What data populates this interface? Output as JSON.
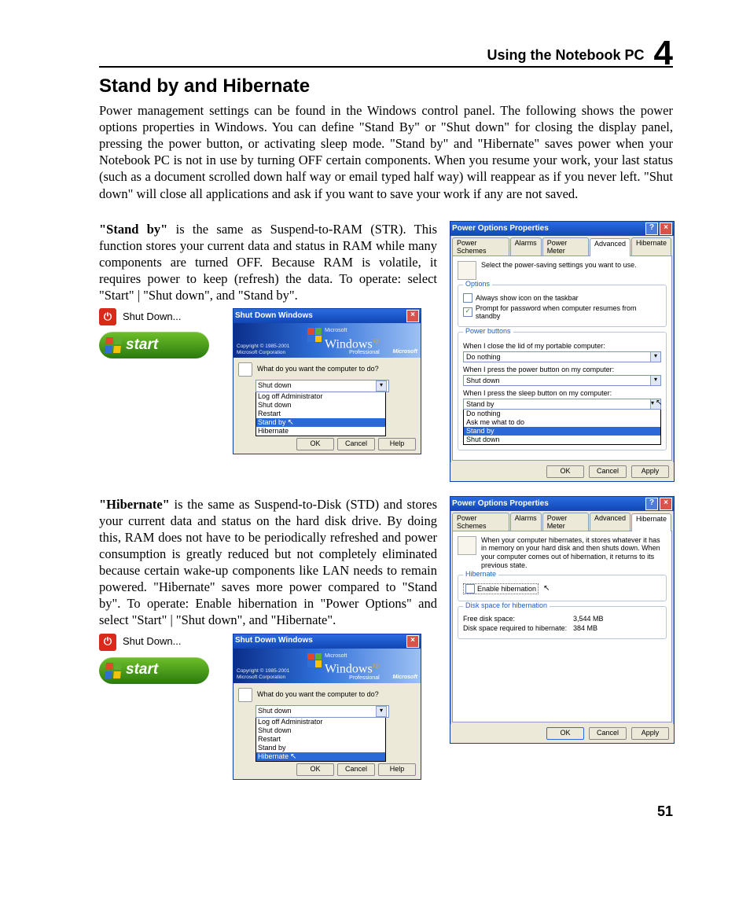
{
  "header": {
    "section_title": "Using the Notebook PC",
    "chapter_number": "4"
  },
  "h1": "Stand by and Hibernate",
  "intro": "Power management settings can be found in the Windows control panel. The following shows the power options properties in Windows. You can define \"Stand By\" or \"Shut down\" for closing the display panel, pressing the power button, or activating sleep mode. \"Stand by\" and \"Hibernate\" saves power when your Notebook PC is not in use by turning OFF certain components. When you resume your work, your last status (such as a document scrolled down half way or email typed half way) will reappear as if you never left. \"Shut down\" will close all applications and ask if you want to save your work if any are not saved.",
  "standby": {
    "bold": "\"Stand by\"",
    "text": " is the same as Suspend-to-RAM (STR). This function stores your current data and status in RAM while many components are turned OFF. Because RAM is volatile, it requires power to keep (refresh) the data. To operate: select \"Start\" | \"Shut down\", and \"Stand by\"."
  },
  "hibernate": {
    "bold": "\"Hibernate\"",
    "text": " is the same as  Suspend-to-Disk (STD) and stores your current data and status on the hard disk drive. By doing this, RAM does not have to be periodically refreshed and power consumption is greatly reduced but not completely eliminated because certain wake-up components like LAN needs to remain powered. \"Hibernate\" saves more power compared to \"Stand by\". To operate: Enable hibernation in \"Power Options\" and select \"Start\" | \"Shut down\", and \"Hibernate\"."
  },
  "start_button": {
    "label": "start"
  },
  "shutdown_item": {
    "label": "Shut Down..."
  },
  "shutdown_dialog": {
    "title": "Shut Down Windows",
    "banner": {
      "ms_top": "Microsoft",
      "product": "Windows",
      "suffix": "xp",
      "edition": "Professional",
      "copyright": "Copyright © 1985-2001\nMicrosoft Corporation",
      "msft": "Microsoft"
    },
    "question": "What do you want the computer to do?",
    "selected": "Shut down",
    "options_standby": [
      "Log off Administrator",
      "Shut down",
      "Restart",
      "Stand by",
      "Hibernate"
    ],
    "options_hibernate": [
      "Log off Administrator",
      "Shut down",
      "Restart",
      "Stand by",
      "Hibernate"
    ],
    "highlight_standby": "Stand by",
    "highlight_hibernate": "Hibernate",
    "buttons": {
      "ok": "OK",
      "cancel": "Cancel",
      "help": "Help"
    }
  },
  "power_options_adv": {
    "title": "Power Options Properties",
    "tabs": [
      "Power Schemes",
      "Alarms",
      "Power Meter",
      "Advanced",
      "Hibernate"
    ],
    "active_tab": "Advanced",
    "desc": "Select the power-saving settings you want to use.",
    "group_options": "Options",
    "opt_taskbar": "Always show icon on the taskbar",
    "opt_password": "Prompt for password when computer resumes from standby",
    "group_power_buttons": "Power buttons",
    "lid_label": "When I close the lid of my portable computer:",
    "lid_value": "Do nothing",
    "power_label": "When I press the power button on my computer:",
    "power_value": "Shut down",
    "sleep_label": "When I press the sleep button on my computer:",
    "sleep_value": "Stand by",
    "sleep_options": [
      "Do nothing",
      "Ask me what to do",
      "Stand by",
      "Shut down"
    ],
    "buttons": {
      "ok": "OK",
      "cancel": "Cancel",
      "apply": "Apply"
    }
  },
  "power_options_hib": {
    "title": "Power Options Properties",
    "tabs": [
      "Power Schemes",
      "Alarms",
      "Power Meter",
      "Advanced",
      "Hibernate"
    ],
    "active_tab": "Hibernate",
    "desc": "When your computer hibernates, it stores whatever it has in memory on your hard disk and then shuts down. When your computer comes out of hibernation, it returns to its previous state.",
    "group_hibernate": "Hibernate",
    "enable": "Enable hibernation",
    "group_disk": "Disk space for hibernation",
    "free_label": "Free disk space:",
    "free_value": "3,544 MB",
    "req_label": "Disk space required to hibernate:",
    "req_value": "384 MB",
    "buttons": {
      "ok": "OK",
      "cancel": "Cancel",
      "apply": "Apply"
    }
  },
  "page_number": "51"
}
